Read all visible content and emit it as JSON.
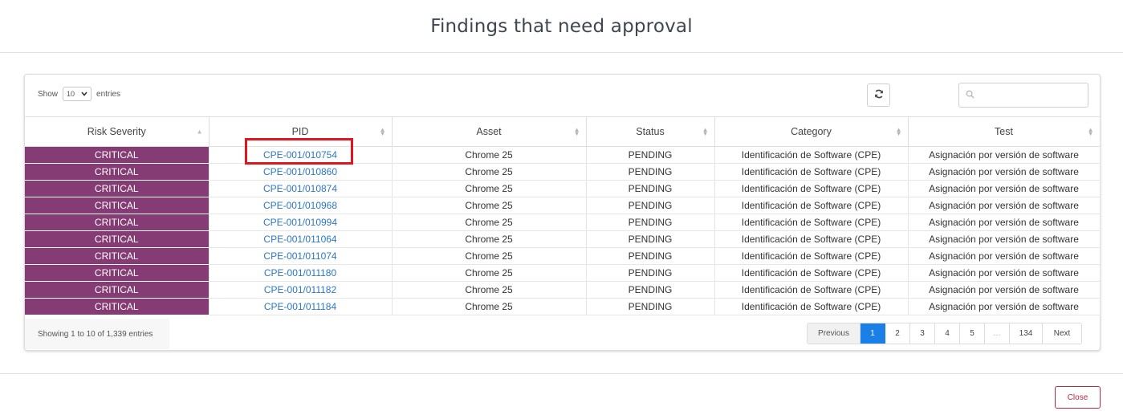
{
  "modal": {
    "title": "Findings that need approval"
  },
  "controls": {
    "show_label": "Show",
    "page_length": "10",
    "entries_label": "entries",
    "search_placeholder": ""
  },
  "table": {
    "columns": [
      "Risk Severity",
      "PID",
      "Asset",
      "Status",
      "Category",
      "Test"
    ],
    "rows": [
      [
        "CRITICAL",
        "CPE-001/010754",
        "Chrome 25",
        "PENDING",
        "Identificación de Software (CPE)",
        "Asignación por versión de software"
      ],
      [
        "CRITICAL",
        "CPE-001/010860",
        "Chrome 25",
        "PENDING",
        "Identificación de Software (CPE)",
        "Asignación por versión de software"
      ],
      [
        "CRITICAL",
        "CPE-001/010874",
        "Chrome 25",
        "PENDING",
        "Identificación de Software (CPE)",
        "Asignación por versión de software"
      ],
      [
        "CRITICAL",
        "CPE-001/010968",
        "Chrome 25",
        "PENDING",
        "Identificación de Software (CPE)",
        "Asignación por versión de software"
      ],
      [
        "CRITICAL",
        "CPE-001/010994",
        "Chrome 25",
        "PENDING",
        "Identificación de Software (CPE)",
        "Asignación por versión de software"
      ],
      [
        "CRITICAL",
        "CPE-001/011064",
        "Chrome 25",
        "PENDING",
        "Identificación de Software (CPE)",
        "Asignación por versión de software"
      ],
      [
        "CRITICAL",
        "CPE-001/011074",
        "Chrome 25",
        "PENDING",
        "Identificación de Software (CPE)",
        "Asignación por versión de software"
      ],
      [
        "CRITICAL",
        "CPE-001/011180",
        "Chrome 25",
        "PENDING",
        "Identificación de Software (CPE)",
        "Asignación por versión de software"
      ],
      [
        "CRITICAL",
        "CPE-001/011182",
        "Chrome 25",
        "PENDING",
        "Identificación de Software (CPE)",
        "Asignación por versión de software"
      ],
      [
        "CRITICAL",
        "CPE-001/011184",
        "Chrome 25",
        "PENDING",
        "Identificación de Software (CPE)",
        "Asignación por versión de software"
      ]
    ],
    "severity_color": "#853b73",
    "link_color": "#2b77c7"
  },
  "info": {
    "text": "Showing 1 to 10 of 1,339 entries"
  },
  "pagination": {
    "previous": "Previous",
    "pages": [
      "1",
      "2",
      "3",
      "4",
      "5"
    ],
    "ellipsis": "…",
    "last": "134",
    "next": "Next",
    "active_page": "1",
    "active_color": "#1b7fe8"
  },
  "footer": {
    "close_label": "Close",
    "close_color": "#b8283f"
  },
  "icons": {
    "refresh": "refresh-icon",
    "search": "search-icon",
    "sort": "sort-icon",
    "select_chevron": "chevron-down-icon"
  },
  "highlight": {
    "target_pid": "CPE-001/010754",
    "color": "#e1151d"
  }
}
